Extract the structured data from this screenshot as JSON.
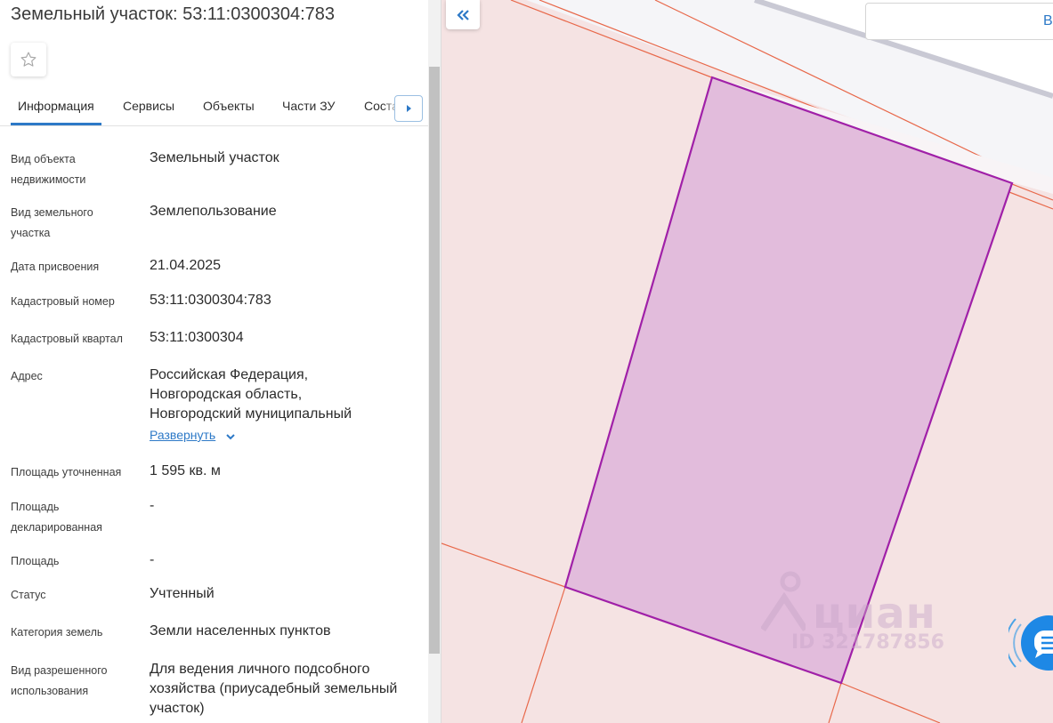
{
  "panel": {
    "title": "Земельный участок: 53:11:0300304:783",
    "tabs": [
      {
        "label": "Информация",
        "active": true
      },
      {
        "label": "Сервисы"
      },
      {
        "label": "Объекты"
      },
      {
        "label": "Части ЗУ"
      },
      {
        "label": "Соста"
      }
    ],
    "fields": [
      {
        "label": "Вид объекта недвижимости",
        "value": "Земельный участок"
      },
      {
        "label": "Вид земельного участка",
        "value": "Землепользование"
      },
      {
        "label": "Дата присвоения",
        "value": "21.04.2025"
      },
      {
        "label": "Кадастровый номер",
        "value": "53:11:0300304:783"
      },
      {
        "label": "Кадастровый квартал",
        "value": "53:11:0300304"
      },
      {
        "label": "Адрес",
        "value": "Российская Федерация, Новгородская область, Новгородский муниципальный"
      },
      {
        "label": "Площадь уточненная",
        "value": "1 595 кв. м"
      },
      {
        "label": "Площадь декларированная",
        "value": "-"
      },
      {
        "label": "Площадь",
        "value": "-"
      },
      {
        "label": "Статус",
        "value": "Учтенный"
      },
      {
        "label": "Категория земель",
        "value": "Земли населенных пунктов"
      },
      {
        "label": "Вид разрешенного использования",
        "value": "Для ведения личного подсобного хозяйства (приусадебный земельный участок)"
      }
    ],
    "expand_link": "Развернуть"
  },
  "map": {
    "search_text": "В",
    "watermark_brand": "циан",
    "watermark_id": "ID 321787856",
    "colors": {
      "background": "#f5e3e3",
      "parcel_fill": "#e2bcdc",
      "parcel_stroke": "#a020a8",
      "boundary_line": "#e8684a",
      "accent": "#2d79c7"
    }
  },
  "icons": {
    "favorite": "star-outline-icon",
    "tabs_next": "chevron-right-icon",
    "expand": "chevron-down-icon",
    "collapse": "double-chevron-left-icon",
    "chat": "chat-bubble-icon"
  }
}
